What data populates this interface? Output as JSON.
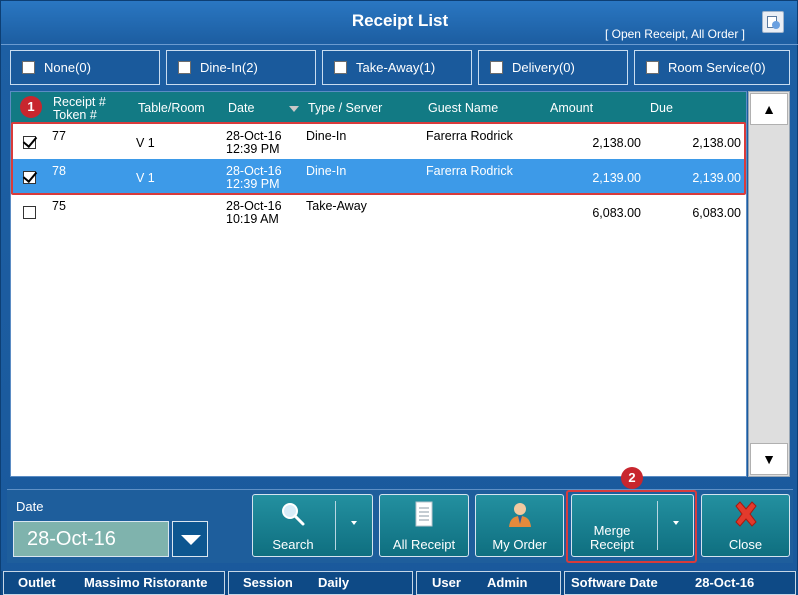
{
  "window": {
    "title": "Receipt List",
    "subtitle": "[ Open Receipt, All Order ]"
  },
  "filters": [
    {
      "label": "None(0)",
      "checked": false
    },
    {
      "label": "Dine-In(2)",
      "checked": false
    },
    {
      "label": "Take-Away(1)",
      "checked": false
    },
    {
      "label": "Delivery(0)",
      "checked": false
    },
    {
      "label": "Room Service(0)",
      "checked": false
    }
  ],
  "grid": {
    "columns": {
      "receipt": "Receipt #",
      "token": "Token #",
      "table": "Table/Room",
      "date": "Date",
      "type": "Type / Server",
      "guest": "Guest Name",
      "amount": "Amount",
      "due": "Due"
    },
    "sort_column": "Date",
    "rows": [
      {
        "checked": true,
        "receipt": "77",
        "table": "V 1",
        "date": "28-Oct-16",
        "time": "12:39 PM",
        "type": "Dine-In",
        "guest": "Farerra Rodrick",
        "amount": "2,138.00",
        "due": "2,138.00",
        "selected": false
      },
      {
        "checked": true,
        "receipt": "78",
        "table": "V 1",
        "date": "28-Oct-16",
        "time": "12:39 PM",
        "type": "Dine-In",
        "guest": "Farerra Rodrick",
        "amount": "2,139.00",
        "due": "2,139.00",
        "selected": true
      },
      {
        "checked": false,
        "receipt": "75",
        "table": "",
        "date": "28-Oct-16",
        "time": "10:19 AM",
        "type": "Take-Away",
        "guest": "",
        "amount": "6,083.00",
        "due": "6,083.00",
        "selected": false
      }
    ]
  },
  "scroll": {
    "up": "▲",
    "down": "▼"
  },
  "annotations": {
    "badge1": "1",
    "badge2": "2"
  },
  "bottom": {
    "date_label": "Date",
    "date_value": "28-Oct-16",
    "buttons": {
      "search": "Search",
      "all_receipt": "All Receipt",
      "my_order": "My Order",
      "merge_receipt_1": "Merge",
      "merge_receipt_2": "Receipt",
      "close": "Close"
    }
  },
  "status": {
    "outlet_label": "Outlet",
    "outlet_value": "Massimo Ristorante",
    "session_label": "Session",
    "session_value": "Daily",
    "user_label": "User",
    "user_value": "Admin",
    "software_date_label": "Software Date",
    "software_date_value": "28-Oct-16"
  },
  "colors": {
    "accent": "#1d5fa3",
    "header_teal": "#127a84",
    "selected_row": "#3d9ae8",
    "highlight": "#d93b3b"
  }
}
